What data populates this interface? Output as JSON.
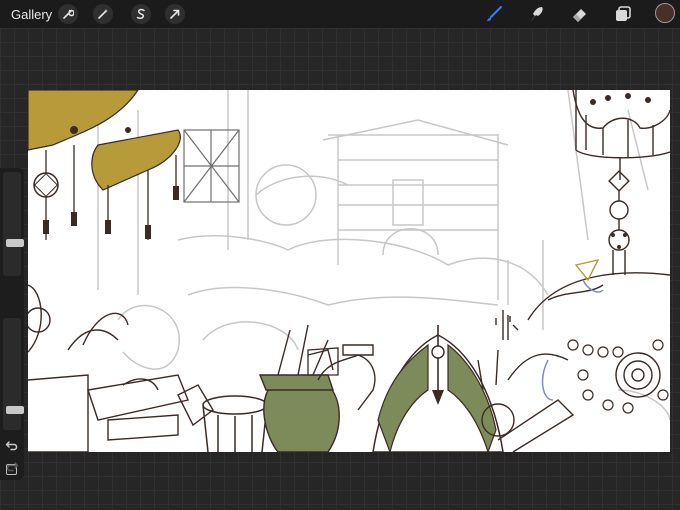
{
  "toolbar": {
    "gallery_label": "Gallery",
    "left_tools": [
      {
        "name": "actions",
        "icon": "wrench-icon"
      },
      {
        "name": "adjustments",
        "icon": "magic-wand-icon"
      },
      {
        "name": "selection",
        "icon": "selection-s-icon"
      },
      {
        "name": "transform",
        "icon": "arrow-cursor-icon"
      }
    ],
    "right_tools": [
      {
        "name": "brush",
        "icon": "brush-icon",
        "active": true
      },
      {
        "name": "smudge",
        "icon": "smudge-icon"
      },
      {
        "name": "eraser",
        "icon": "eraser-icon"
      },
      {
        "name": "layers",
        "icon": "layers-icon"
      }
    ],
    "current_color": "#4a2e28",
    "accent_color": "#2f7cf6"
  },
  "sidebar": {
    "brush_size_level": 0.3,
    "opacity_level": 0.15,
    "controls": [
      "brush-size-slider",
      "modify-button",
      "opacity-slider",
      "undo-button",
      "redo-button"
    ]
  },
  "canvas": {
    "ink_color": "#3c2a24",
    "sketch_color": "#bdbdbd",
    "gold_color": "#b79a3a",
    "green_color": "#7d8a5a"
  }
}
